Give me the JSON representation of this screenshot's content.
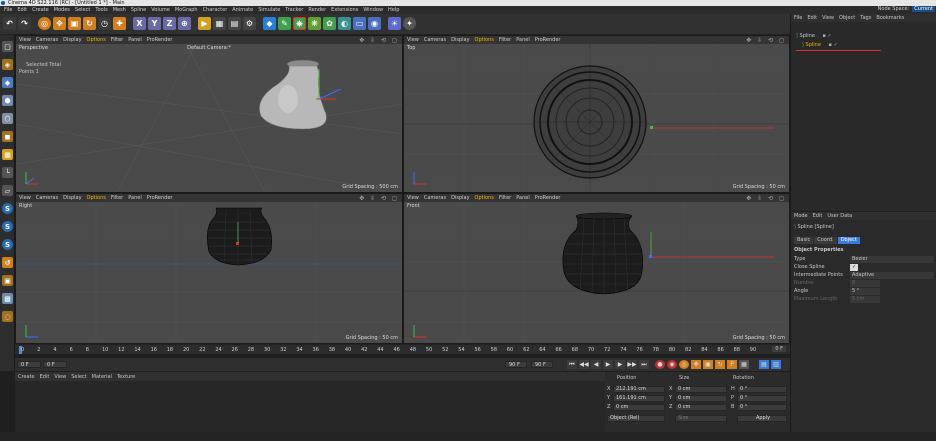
{
  "window": {
    "title": "Cinema 4D S22.116 (RC) - [Untitled 1 *] - Main"
  },
  "menu": [
    "File",
    "Edit",
    "Create",
    "Modes",
    "Select",
    "Tools",
    "Mesh",
    "Spline",
    "Volume",
    "MoGraph",
    "Character",
    "Animate",
    "Simulate",
    "Tracker",
    "Render",
    "Extensions",
    "Window",
    "Help"
  ],
  "menu_right": {
    "node_space": "Node Space:",
    "layout": "Current"
  },
  "viewports": {
    "menu": [
      "View",
      "Cameras",
      "Display",
      "Options",
      "Filter",
      "Panel",
      "ProRender"
    ],
    "perspective": {
      "label": "Perspective",
      "camera": "Default Camera:*",
      "info_title": "Selected Total",
      "info_points": "Points  1",
      "grid": "Grid Spacing : 500 cm"
    },
    "top": {
      "label": "Top",
      "grid": "Grid Spacing : 50 cm"
    },
    "right": {
      "label": "Right",
      "grid": "Grid Spacing : 50 cm"
    },
    "front": {
      "label": "Front",
      "grid": "Grid Spacing : 50 cm"
    },
    "navigation_icons": "✥ ⇩ ⟲ ◻"
  },
  "timeline": {
    "ticks": [
      "0",
      "2",
      "4",
      "6",
      "8",
      "10",
      "12",
      "14",
      "16",
      "18",
      "20",
      "22",
      "24",
      "26",
      "28",
      "30",
      "32",
      "34",
      "36",
      "38",
      "40",
      "42",
      "44",
      "46",
      "48",
      "50",
      "52",
      "54",
      "56",
      "58",
      "60",
      "62",
      "64",
      "66",
      "68",
      "70",
      "72",
      "74",
      "76",
      "78",
      "80",
      "82",
      "84",
      "86",
      "88",
      "90"
    ],
    "frame_right": "0 F"
  },
  "transport": {
    "start": "0 F",
    "current": "0 F",
    "end": "90 F",
    "end2": "90 F"
  },
  "material_menu": [
    "Create",
    "Edit",
    "View",
    "Select",
    "Material",
    "Texture"
  ],
  "coords": {
    "headers": {
      "position": "Position",
      "size": "Size",
      "rotation": "Rotation"
    },
    "rows": [
      {
        "axis": "X",
        "pos": "212.191 cm",
        "saxis": "X",
        "size": "0 cm",
        "raxis": "H",
        "rot": "0 °"
      },
      {
        "axis": "Y",
        "pos": "161.191 cm",
        "saxis": "Y",
        "size": "0 cm",
        "raxis": "P",
        "rot": "0 °"
      },
      {
        "axis": "Z",
        "pos": "0 cm",
        "saxis": "Z",
        "size": "0 cm",
        "raxis": "B",
        "rot": "0 °"
      }
    ],
    "mode": "Object (Rel)",
    "size_mode": "Size",
    "apply": "Apply"
  },
  "object_manager": {
    "menu": [
      "File",
      "Edit",
      "View",
      "Object",
      "Tags",
      "Bookmarks"
    ],
    "objects": [
      {
        "name": "Spline",
        "selected": false
      },
      {
        "name": "Spline",
        "selected": true
      }
    ]
  },
  "attributes": {
    "menu": [
      "Mode",
      "Edit",
      "User Data"
    ],
    "object_title": "Spline [Spline]",
    "tabs": [
      "Basic",
      "Coord.",
      "Object"
    ],
    "section": "Object Properties",
    "props": [
      {
        "label": "Type",
        "value": "Bezier"
      },
      {
        "label": "Close Spline",
        "value": "✓"
      },
      {
        "label": "Intermediate Points",
        "value": "Adaptive"
      },
      {
        "label": "Number",
        "value": "8"
      },
      {
        "label": "Angle",
        "value": "5 °"
      },
      {
        "label": "Maximum Length",
        "value": "5 cm"
      }
    ]
  },
  "colors": {
    "accent": "#3a7bd5",
    "highlight": "#f5b400",
    "selection_red": "#e03030"
  }
}
